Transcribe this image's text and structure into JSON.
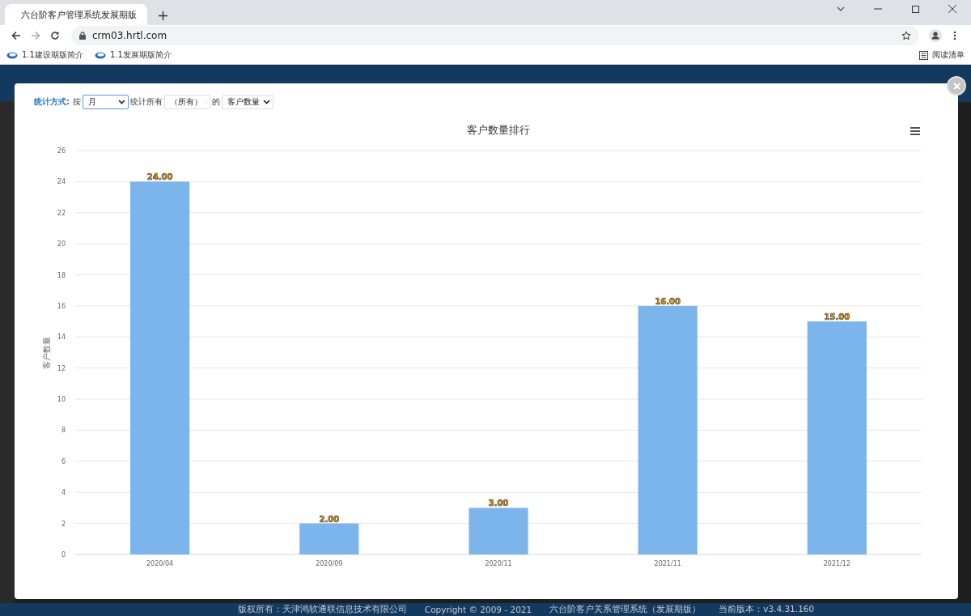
{
  "browser": {
    "tab": {
      "title": "六台阶客户管理系统发展期版"
    },
    "url": "crm03.hrtl.com",
    "bookmarks": [
      {
        "label": "1.1建设期版简介"
      },
      {
        "label": "1.1发展期版简介"
      }
    ],
    "reading_list": "阅读清单"
  },
  "dialog": {
    "filter": {
      "label": "统计方式:",
      "prefix": "按",
      "period": "月",
      "middle": "统计所有",
      "scope": "（所有）",
      "of": "的",
      "metric": "客户数量"
    },
    "chart_data": {
      "type": "bar",
      "title": "客户数量排行",
      "ylabel": "客户数量",
      "categories": [
        "2020/04",
        "2020/09",
        "2020/11",
        "2021/11",
        "2021/12"
      ],
      "values": [
        24,
        2,
        3,
        16,
        15
      ],
      "ylim": [
        0,
        26
      ],
      "yticks": [
        0,
        2,
        4,
        6,
        8,
        10,
        12,
        14,
        16,
        18,
        20,
        22,
        24,
        26
      ],
      "value_labels": [
        "24.00",
        "2.00",
        "3.00",
        "16.00",
        "15.00"
      ],
      "grid": true
    }
  },
  "footer": [
    "版权所有：天津鸿软通联信息技术有限公司",
    "Copyright © 2009 - 2021",
    "六台阶客户关系管理系统（发展期版）",
    "当前版本：v3.4.31.160"
  ]
}
